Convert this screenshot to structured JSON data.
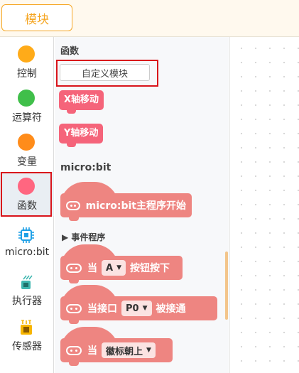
{
  "header": {
    "tab_label": "模块"
  },
  "categories": [
    {
      "label": "控制",
      "color": "#ffab19"
    },
    {
      "label": "运算符",
      "color": "#40bf4a"
    },
    {
      "label": "变量",
      "color": "#ff8c1a"
    },
    {
      "label": "函数",
      "color": "#ff6680",
      "selected": true
    },
    {
      "label": "micro:bit",
      "icon": "microbit-chip-icon"
    },
    {
      "label": "执行器",
      "icon": "actuator-chip-icon"
    },
    {
      "label": "传感器",
      "icon": "sensor-chip-icon"
    }
  ],
  "flyout": {
    "functions_title": "函数",
    "custom_block_button": "自定义模块",
    "blocks": [
      "X轴移动",
      "Y轴移动"
    ],
    "microbit_title": "micro:bit",
    "main_program_block": "micro:bit主程序开始",
    "events_expand_label": "▶ 事件程序",
    "button_event": {
      "prefix": "当",
      "button": "A",
      "suffix": "按钮按下"
    },
    "pin_event": {
      "prefix": "当接口",
      "pin": "P0",
      "suffix": "被接通"
    },
    "gesture_event": {
      "prefix": "当",
      "gesture": "徽标朝上"
    }
  },
  "colors": {
    "accent": "#f5a623",
    "selected_outline": "#d9141b",
    "function_block": "#f5647a",
    "microbit_block": "#ee8581"
  }
}
